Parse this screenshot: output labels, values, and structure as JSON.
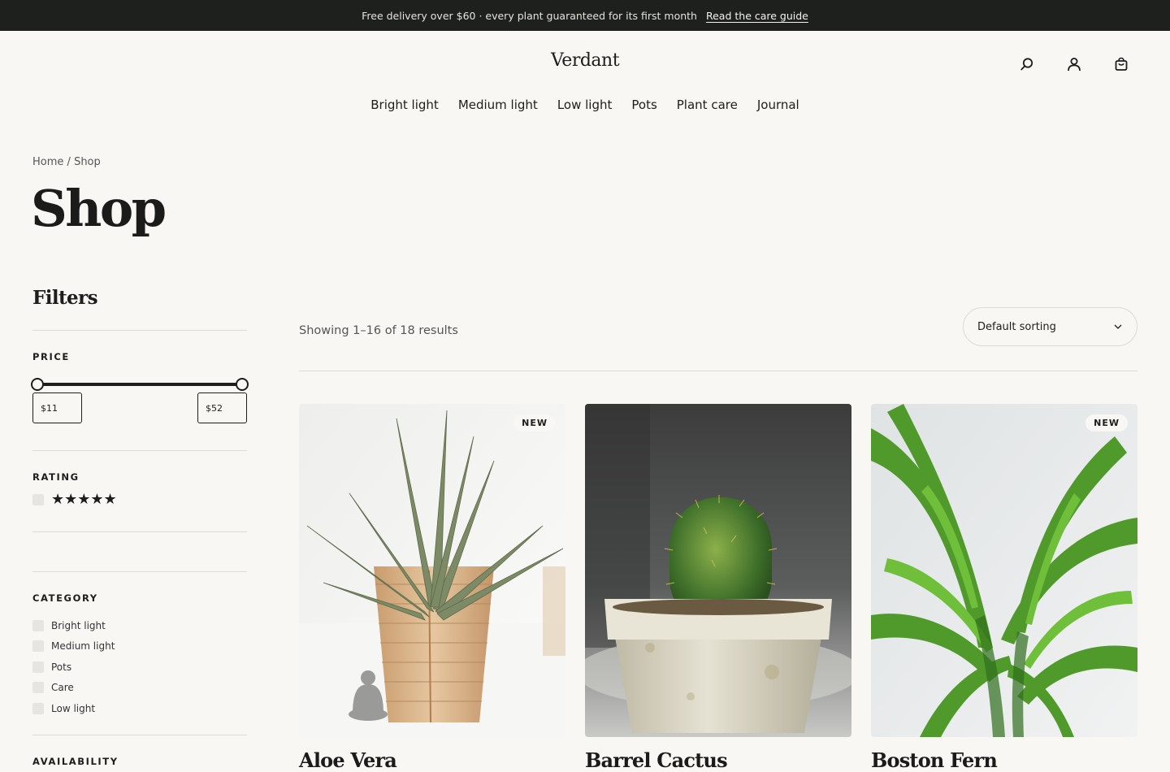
{
  "announcement": {
    "text": "Free delivery over $60 · every plant guaranteed for its first month",
    "link": "Read the care guide"
  },
  "header": {
    "logo": "Verdant",
    "icons": [
      "search-icon",
      "account-icon",
      "bag-icon"
    ]
  },
  "nav": {
    "items": [
      "Bright light",
      "Medium light",
      "Low light",
      "Pots",
      "Plant care",
      "Journal"
    ]
  },
  "breadcrumb": {
    "home": "Home",
    "separator": "/",
    "current": "Shop"
  },
  "page": {
    "title": "Shop"
  },
  "filters": {
    "title": "Filters",
    "price": {
      "label": "PRICE",
      "min": "$11",
      "max": "$52"
    },
    "rating": {
      "label": "RATING",
      "stars": "★★★★★"
    },
    "category": {
      "label": "CATEGORY",
      "items": [
        "Bright light",
        "Medium light",
        "Pots",
        "Care",
        "Low light"
      ]
    },
    "availability": {
      "label": "AVAILABILITY"
    }
  },
  "listing": {
    "results": "Showing 1–16 of 18 results",
    "sort": "Default sorting"
  },
  "products": [
    {
      "name": "Aloe Vera",
      "badge": "NEW"
    },
    {
      "name": "Barrel Cactus",
      "badge": ""
    },
    {
      "name": "Boston Fern",
      "badge": "NEW"
    }
  ],
  "colors": {
    "background": "#f8f7f3",
    "announcement_bar": "#1e201d",
    "text": "#1d1d1b",
    "rule": "#dcdbd6"
  }
}
